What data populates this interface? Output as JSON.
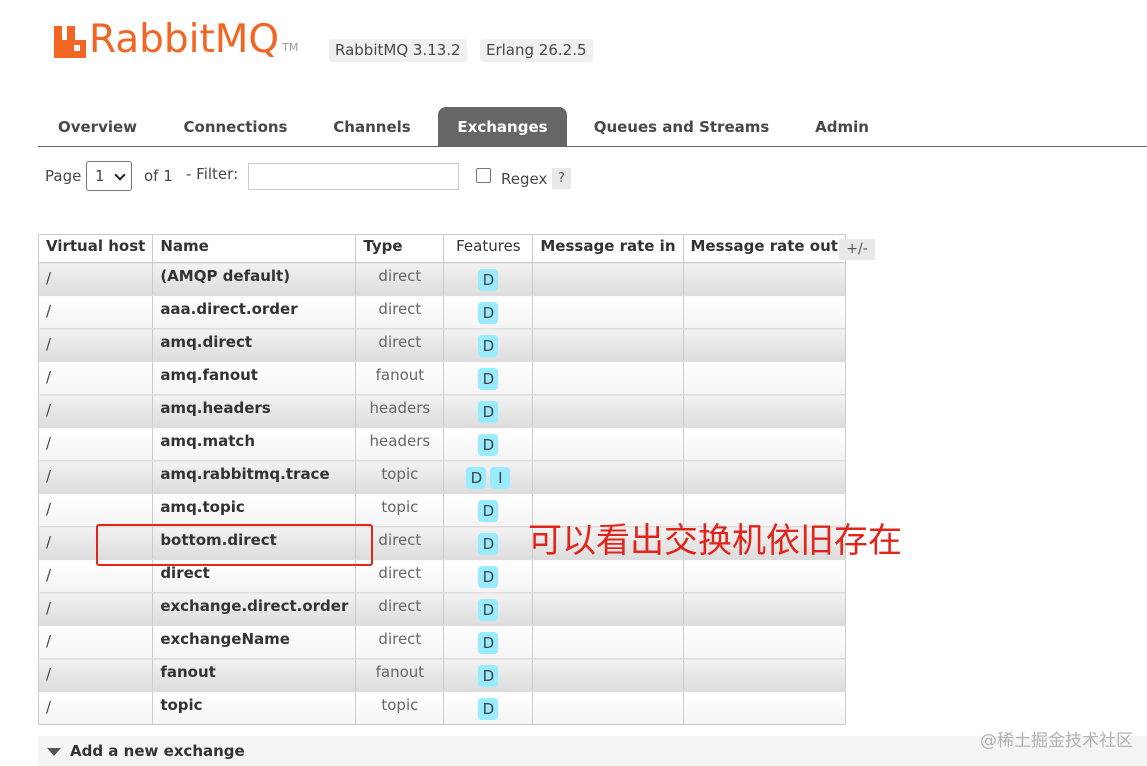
{
  "header": {
    "logo_text": "RabbitMQ",
    "logo_tm": "TM",
    "version": "RabbitMQ 3.13.2",
    "erlang": "Erlang 26.2.5",
    "brand_color": "#f26522"
  },
  "tabs": [
    {
      "label": "Overview",
      "active": false
    },
    {
      "label": "Connections",
      "active": false
    },
    {
      "label": "Channels",
      "active": false
    },
    {
      "label": "Exchanges",
      "active": true
    },
    {
      "label": "Queues and Streams",
      "active": false
    },
    {
      "label": "Admin",
      "active": false
    }
  ],
  "paging": {
    "page_label": "Page",
    "page_value": "1",
    "of_label": "of 1",
    "filter_label": "- Filter:",
    "filter_value": "",
    "regex_label": "Regex",
    "help": "?"
  },
  "table": {
    "columns": [
      "Virtual host",
      "Name",
      "Type",
      "Features",
      "Message rate in",
      "Message rate out"
    ],
    "plus_minus": "+/-",
    "rows": [
      {
        "vhost": "/",
        "name": "(AMQP default)",
        "type": "direct",
        "features": [
          "D"
        ]
      },
      {
        "vhost": "/",
        "name": "aaa.direct.order",
        "type": "direct",
        "features": [
          "D"
        ]
      },
      {
        "vhost": "/",
        "name": "amq.direct",
        "type": "direct",
        "features": [
          "D"
        ]
      },
      {
        "vhost": "/",
        "name": "amq.fanout",
        "type": "fanout",
        "features": [
          "D"
        ]
      },
      {
        "vhost": "/",
        "name": "amq.headers",
        "type": "headers",
        "features": [
          "D"
        ]
      },
      {
        "vhost": "/",
        "name": "amq.match",
        "type": "headers",
        "features": [
          "D"
        ]
      },
      {
        "vhost": "/",
        "name": "amq.rabbitmq.trace",
        "type": "topic",
        "features": [
          "D",
          "I"
        ]
      },
      {
        "vhost": "/",
        "name": "amq.topic",
        "type": "topic",
        "features": [
          "D"
        ]
      },
      {
        "vhost": "/",
        "name": "bottom.direct",
        "type": "direct",
        "features": [
          "D"
        ]
      },
      {
        "vhost": "/",
        "name": "direct",
        "type": "direct",
        "features": [
          "D"
        ]
      },
      {
        "vhost": "/",
        "name": "exchange.direct.order",
        "type": "direct",
        "features": [
          "D"
        ]
      },
      {
        "vhost": "/",
        "name": "exchangeName",
        "type": "direct",
        "features": [
          "D"
        ]
      },
      {
        "vhost": "/",
        "name": "fanout",
        "type": "fanout",
        "features": [
          "D"
        ]
      },
      {
        "vhost": "/",
        "name": "topic",
        "type": "topic",
        "features": [
          "D"
        ]
      }
    ]
  },
  "annotation": {
    "text": "可以看出交换机依旧存在",
    "color": "#e1251b"
  },
  "footer": {
    "add_exchange": "Add a new exchange"
  },
  "watermark": "@稀土掘金技术社区"
}
